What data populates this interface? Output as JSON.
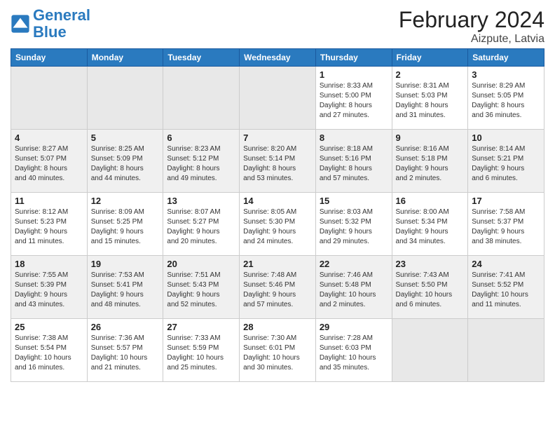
{
  "logo": {
    "line1": "General",
    "line2": "Blue"
  },
  "title": "February 2024",
  "subtitle": "Aizpute, Latvia",
  "days_of_week": [
    "Sunday",
    "Monday",
    "Tuesday",
    "Wednesday",
    "Thursday",
    "Friday",
    "Saturday"
  ],
  "weeks": [
    [
      {
        "day": "",
        "data": ""
      },
      {
        "day": "",
        "data": ""
      },
      {
        "day": "",
        "data": ""
      },
      {
        "day": "",
        "data": ""
      },
      {
        "day": "1",
        "data": "Sunrise: 8:33 AM\nSunset: 5:00 PM\nDaylight: 8 hours\nand 27 minutes."
      },
      {
        "day": "2",
        "data": "Sunrise: 8:31 AM\nSunset: 5:03 PM\nDaylight: 8 hours\nand 31 minutes."
      },
      {
        "day": "3",
        "data": "Sunrise: 8:29 AM\nSunset: 5:05 PM\nDaylight: 8 hours\nand 36 minutes."
      }
    ],
    [
      {
        "day": "4",
        "data": "Sunrise: 8:27 AM\nSunset: 5:07 PM\nDaylight: 8 hours\nand 40 minutes."
      },
      {
        "day": "5",
        "data": "Sunrise: 8:25 AM\nSunset: 5:09 PM\nDaylight: 8 hours\nand 44 minutes."
      },
      {
        "day": "6",
        "data": "Sunrise: 8:23 AM\nSunset: 5:12 PM\nDaylight: 8 hours\nand 49 minutes."
      },
      {
        "day": "7",
        "data": "Sunrise: 8:20 AM\nSunset: 5:14 PM\nDaylight: 8 hours\nand 53 minutes."
      },
      {
        "day": "8",
        "data": "Sunrise: 8:18 AM\nSunset: 5:16 PM\nDaylight: 8 hours\nand 57 minutes."
      },
      {
        "day": "9",
        "data": "Sunrise: 8:16 AM\nSunset: 5:18 PM\nDaylight: 9 hours\nand 2 minutes."
      },
      {
        "day": "10",
        "data": "Sunrise: 8:14 AM\nSunset: 5:21 PM\nDaylight: 9 hours\nand 6 minutes."
      }
    ],
    [
      {
        "day": "11",
        "data": "Sunrise: 8:12 AM\nSunset: 5:23 PM\nDaylight: 9 hours\nand 11 minutes."
      },
      {
        "day": "12",
        "data": "Sunrise: 8:09 AM\nSunset: 5:25 PM\nDaylight: 9 hours\nand 15 minutes."
      },
      {
        "day": "13",
        "data": "Sunrise: 8:07 AM\nSunset: 5:27 PM\nDaylight: 9 hours\nand 20 minutes."
      },
      {
        "day": "14",
        "data": "Sunrise: 8:05 AM\nSunset: 5:30 PM\nDaylight: 9 hours\nand 24 minutes."
      },
      {
        "day": "15",
        "data": "Sunrise: 8:03 AM\nSunset: 5:32 PM\nDaylight: 9 hours\nand 29 minutes."
      },
      {
        "day": "16",
        "data": "Sunrise: 8:00 AM\nSunset: 5:34 PM\nDaylight: 9 hours\nand 34 minutes."
      },
      {
        "day": "17",
        "data": "Sunrise: 7:58 AM\nSunset: 5:37 PM\nDaylight: 9 hours\nand 38 minutes."
      }
    ],
    [
      {
        "day": "18",
        "data": "Sunrise: 7:55 AM\nSunset: 5:39 PM\nDaylight: 9 hours\nand 43 minutes."
      },
      {
        "day": "19",
        "data": "Sunrise: 7:53 AM\nSunset: 5:41 PM\nDaylight: 9 hours\nand 48 minutes."
      },
      {
        "day": "20",
        "data": "Sunrise: 7:51 AM\nSunset: 5:43 PM\nDaylight: 9 hours\nand 52 minutes."
      },
      {
        "day": "21",
        "data": "Sunrise: 7:48 AM\nSunset: 5:46 PM\nDaylight: 9 hours\nand 57 minutes."
      },
      {
        "day": "22",
        "data": "Sunrise: 7:46 AM\nSunset: 5:48 PM\nDaylight: 10 hours\nand 2 minutes."
      },
      {
        "day": "23",
        "data": "Sunrise: 7:43 AM\nSunset: 5:50 PM\nDaylight: 10 hours\nand 6 minutes."
      },
      {
        "day": "24",
        "data": "Sunrise: 7:41 AM\nSunset: 5:52 PM\nDaylight: 10 hours\nand 11 minutes."
      }
    ],
    [
      {
        "day": "25",
        "data": "Sunrise: 7:38 AM\nSunset: 5:54 PM\nDaylight: 10 hours\nand 16 minutes."
      },
      {
        "day": "26",
        "data": "Sunrise: 7:36 AM\nSunset: 5:57 PM\nDaylight: 10 hours\nand 21 minutes."
      },
      {
        "day": "27",
        "data": "Sunrise: 7:33 AM\nSunset: 5:59 PM\nDaylight: 10 hours\nand 25 minutes."
      },
      {
        "day": "28",
        "data": "Sunrise: 7:30 AM\nSunset: 6:01 PM\nDaylight: 10 hours\nand 30 minutes."
      },
      {
        "day": "29",
        "data": "Sunrise: 7:28 AM\nSunset: 6:03 PM\nDaylight: 10 hours\nand 35 minutes."
      },
      {
        "day": "",
        "data": ""
      },
      {
        "day": "",
        "data": ""
      }
    ]
  ]
}
